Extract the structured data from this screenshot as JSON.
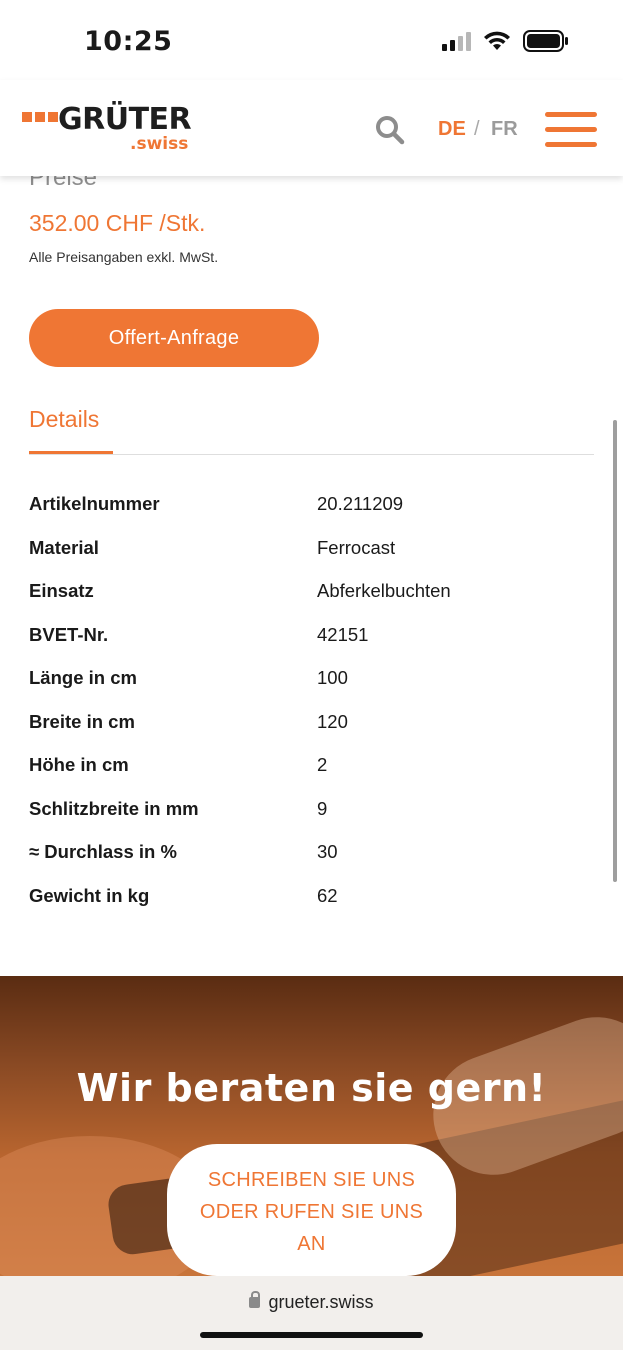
{
  "status_bar": {
    "time": "10:25"
  },
  "header": {
    "logo_word": "GRÜTER",
    "logo_sub": ".swiss",
    "lang_active": "DE",
    "lang_separator": "/",
    "lang_other": "FR"
  },
  "product": {
    "prices_heading": "Preise",
    "price": "352.00 CHF /Stk.",
    "price_note": "Alle Preisangaben exkl. MwSt.",
    "offer_button": "Offert-Anfrage",
    "tab_details": "Details"
  },
  "details": [
    {
      "label": "Artikelnummer",
      "value": "20.211209"
    },
    {
      "label": "Material",
      "value": "Ferrocast"
    },
    {
      "label": "Einsatz",
      "value": "Abferkelbuchten"
    },
    {
      "label": "BVET-Nr.",
      "value": "42151"
    },
    {
      "label": "Länge in cm",
      "value": "100"
    },
    {
      "label": "Breite in cm",
      "value": "120"
    },
    {
      "label": "Höhe in cm",
      "value": "2"
    },
    {
      "label": "Schlitzbreite in mm",
      "value": "9"
    },
    {
      "label": "≈ Durchlass in %",
      "value": "30"
    },
    {
      "label": "Gewicht in kg",
      "value": "62"
    }
  ],
  "banner": {
    "title": "Wir beraten sie gern!",
    "contact_line1": "SCHREIBEN SIE UNS",
    "contact_line2": "ODER RUFEN SIE UNS",
    "contact_line3": "AN"
  },
  "browser": {
    "url": "grueter.swiss"
  },
  "colors": {
    "accent": "#ef7634",
    "text": "#1a1a1a",
    "muted": "#8e8e8e"
  }
}
